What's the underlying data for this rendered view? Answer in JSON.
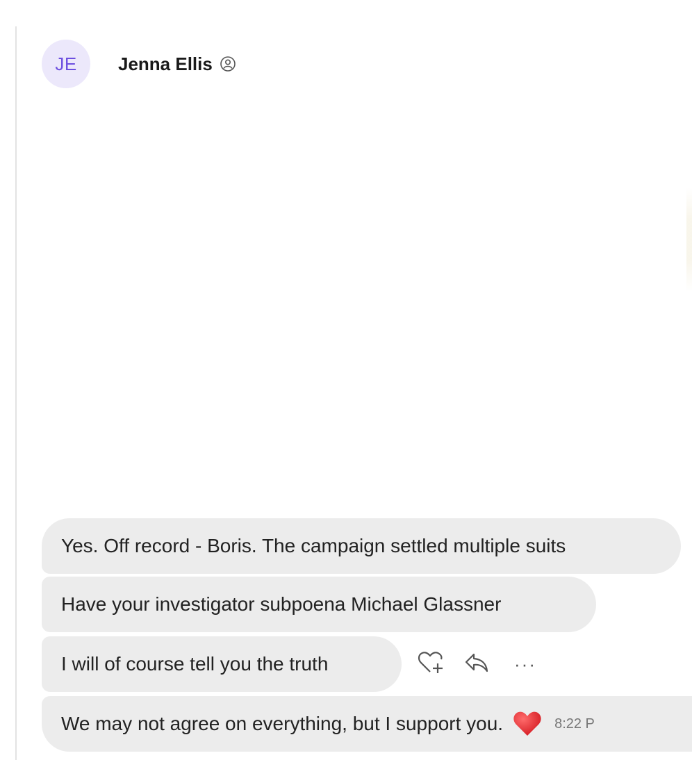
{
  "contact": {
    "initials": "JE",
    "name": "Jenna Ellis"
  },
  "messages": [
    {
      "text": "Yes. Off record - Boris. The campaign settled multiple suits"
    },
    {
      "text": "Have your investigator subpoena Michael Glassner"
    },
    {
      "text": "I will of course tell you the truth"
    },
    {
      "text": "We may not agree on everything, but I support you.",
      "reaction": "heart",
      "time": "8:22 P"
    }
  ],
  "message_actions": {
    "icons": [
      "heart-plus-icon",
      "reply-icon",
      "more-icon"
    ],
    "more_label": "···"
  },
  "colors": {
    "avatar_bg": "#ece8fb",
    "avatar_text": "#6d4fe0",
    "bubble_bg": "#ececec",
    "heart": "#e0252b"
  }
}
